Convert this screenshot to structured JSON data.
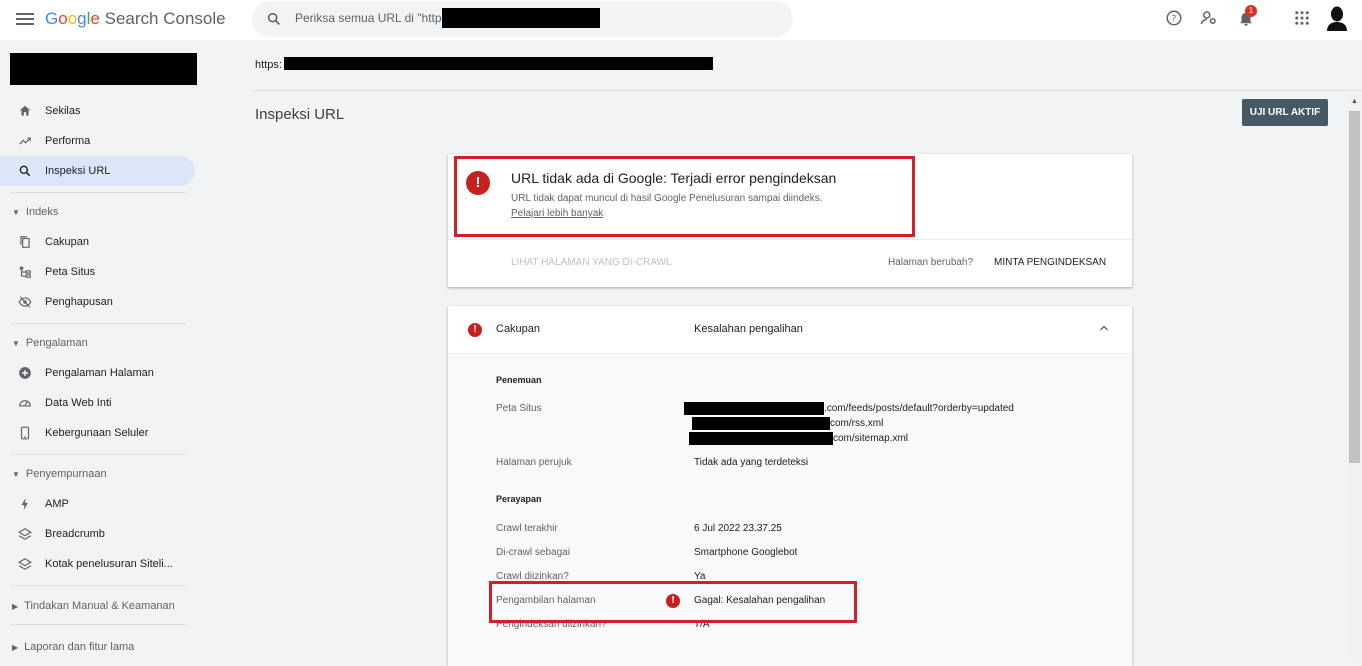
{
  "app": {
    "brand": "Google Search Console",
    "brand_letters": [
      "G",
      "o",
      "o",
      "g",
      "l",
      "e"
    ],
    "brand_suffix": "Search Console"
  },
  "search": {
    "placeholder": "Periksa semua URL di \"http"
  },
  "header": {
    "notification_count": "1"
  },
  "inspected_url_prefix": "https:",
  "sidebar": {
    "items_top": [
      {
        "label": "Sekilas",
        "icon": "home-icon"
      },
      {
        "label": "Performa",
        "icon": "trending-icon"
      },
      {
        "label": "Inspeksi URL",
        "icon": "search-icon",
        "active": true
      }
    ],
    "sections": [
      {
        "title": "Indeks",
        "items": [
          {
            "label": "Cakupan",
            "icon": "copy-icon"
          },
          {
            "label": "Peta Situs",
            "icon": "sitemap-icon"
          },
          {
            "label": "Penghapusan",
            "icon": "eye-off-icon"
          }
        ]
      },
      {
        "title": "Pengalaman",
        "items": [
          {
            "label": "Pengalaman Halaman",
            "icon": "plus-circle-icon"
          },
          {
            "label": "Data Web Inti",
            "icon": "gauge-icon"
          },
          {
            "label": "Kebergunaan Seluler",
            "icon": "phone-icon"
          }
        ]
      },
      {
        "title": "Penyempurnaan",
        "items": [
          {
            "label": "AMP",
            "icon": "bolt-icon"
          },
          {
            "label": "Breadcrumb",
            "icon": "layers-icon"
          },
          {
            "label": "Kotak penelusuran Siteli...",
            "icon": "layers-icon"
          }
        ]
      },
      {
        "title": "Tindakan Manual & Keamanan",
        "items": []
      },
      {
        "title": "Laporan dan fitur lama",
        "items": []
      }
    ]
  },
  "main": {
    "title": "Inspeksi URL",
    "live_test_button": "UJI URL AKTIF",
    "status_card": {
      "title": "URL tidak ada di Google: Terjadi error pengindeksan",
      "description": "URL tidak dapat muncul di hasil Google Penelusuran sampai diindeks.",
      "learn_more": "Pelajari lebih banyak",
      "view_crawled": "LIHAT HALAMAN YANG DI-CRAWL",
      "page_changed": "Halaman berubah?",
      "request_indexing": "MINTA PENGINDEKSAN"
    },
    "coverage_card": {
      "label": "Cakupan",
      "value": "Kesalahan pengalihan",
      "discovery": {
        "heading": "Penemuan",
        "sitemaps_label": "Peta Situs",
        "sitemaps": [
          ".com/feeds/posts/default?orderby=updated",
          "com/rss.xml",
          "com/sitemap.xml"
        ],
        "referring_label": "Halaman perujuk",
        "referring_value": "Tidak ada yang terdeteksi"
      },
      "crawl": {
        "heading": "Perayapan",
        "rows": [
          {
            "label": "Crawl terakhir",
            "value": "6 Jul 2022 23.37.25"
          },
          {
            "label": "Di-crawl sebagai",
            "value": "Smartphone Googlebot"
          },
          {
            "label": "Crawl diizinkan?",
            "value": "Ya"
          },
          {
            "label": "Pengambilan halaman",
            "value": "Gagal: Kesalahan pengalihan",
            "error": true
          },
          {
            "label": "Pengindeksan diizinkan?",
            "value": "T/A"
          }
        ]
      }
    }
  },
  "colors": {
    "error": "#c5221f",
    "highlight": "#d0202a",
    "active_nav": "#dce6f8",
    "button": "#455a64"
  }
}
